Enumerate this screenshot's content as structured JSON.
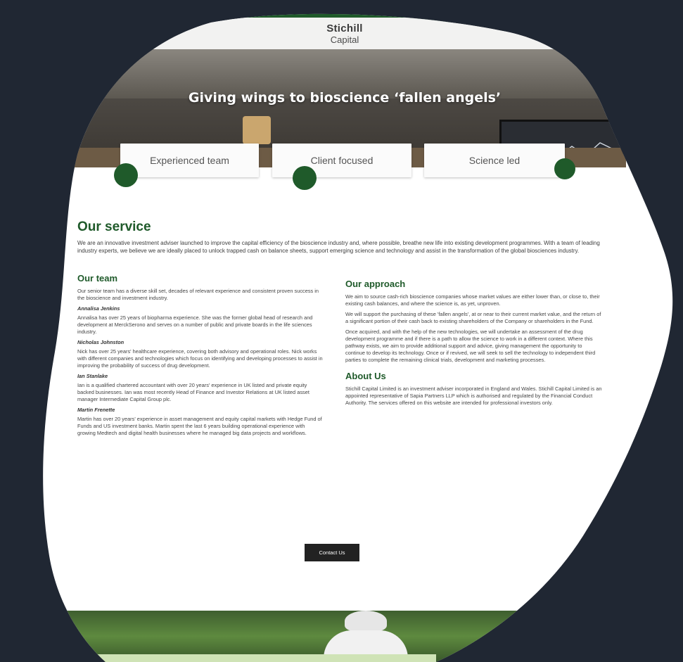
{
  "header": {
    "logo_main": "Stichill",
    "logo_sub": "Capital"
  },
  "hero": {
    "title": "Giving wings to bioscience ‘fallen angels’"
  },
  "features": [
    "Experienced team",
    "Client focused",
    "Science led"
  ],
  "service": {
    "title": "Our service",
    "text": "We are an innovative investment adviser launched to improve the capital efficiency of the bioscience industry and, where possible, breathe new life into existing development programmes. With a team of leading industry experts, we believe we are ideally placed to unlock trapped cash on balance sheets, support emerging science and technology and assist in the transformation of the global biosciences industry."
  },
  "team": {
    "title": "Our team",
    "intro": "Our senior team has a diverse skill set, decades of relevant experience and consistent proven success in the bioscience and investment industry.",
    "members": [
      {
        "name": "Annalisa Jenkins",
        "bio": "Annalisa has over 25 years of biopharma experience. She was the former global head of research and development at MerckSerono and serves on a number of public and private boards in the life sciences industry."
      },
      {
        "name": "Nicholas Johnston",
        "bio": "Nick has over 25 years' healthcare experience, covering both advisory and operational roles. Nick works with different companies and technologies which focus on identifying and developing processes to assist in improving the probability of success of drug development."
      },
      {
        "name": "Ian Stanlake",
        "bio": "Ian is a qualified chartered accountant with over 20 years' experience in UK listed and private equity backed businesses. Ian was most recently Head of Finance and Investor Relations at UK listed asset manager Intermediate Capital Group plc."
      },
      {
        "name": "Martin Frenette",
        "bio": "Martin has over 20 years' experience in asset management and equity capital markets with Hedge Fund of Funds and US investment banks. Martin spent the last 6 years building operational experience with growing Medtech and digital health businesses where he managed big data projects and workflows."
      }
    ]
  },
  "approach": {
    "title": "Our approach",
    "paragraphs": [
      "We aim to source cash-rich bioscience companies whose market values are either lower than, or close to, their existing cash balances, and where the science is, as yet, unproven.",
      "We will support the purchasing of these 'fallen angels', at or near to their current market value, and the return of a significant portion of their cash back to existing shareholders of the Company or shareholders in the Fund.",
      "Once acquired, and with the help of the new technologies, we will undertake an assessment of the drug development programme and if there is a path to allow the science to work in a different context. Where this pathway exists, we aim to provide additional support and advice, giving management the opportunity to continue to develop its technology. Once or if revived, we will seek to sell the technology to independent third parties to complete the remaining clinical trials, development and marketing processes."
    ]
  },
  "about": {
    "title": "About Us",
    "text": "Stichill Capital Limited is an investment adviser incorporated in England and Wales. Stichill Capital Limited is an appointed representative of Sapia Partners LLP which is authorised and regulated by the Financial Conduct Authority. The services offered on this website are intended for professional investors only."
  },
  "contact": {
    "button_label": "Contact Us"
  },
  "colors": {
    "background": "#202733",
    "brand_green": "#1f5a2a",
    "page_bg": "#ffffff"
  }
}
